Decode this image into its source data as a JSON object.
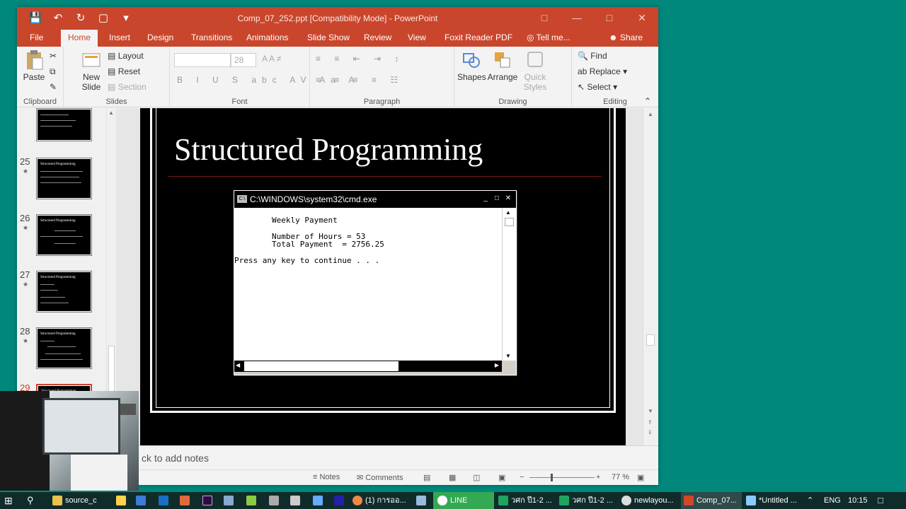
{
  "window": {
    "title": "Comp_07_252.ppt [Compatibility Mode] - PowerPoint",
    "tabs": [
      "File",
      "Home",
      "Insert",
      "Design",
      "Transitions",
      "Animations",
      "Slide Show",
      "Review",
      "View",
      "Foxit Reader PDF",
      "Tell me...",
      "Share"
    ],
    "active_tab": "Home"
  },
  "ribbon": {
    "clipboard": {
      "paste": "Paste",
      "group": "Clipboard"
    },
    "slides": {
      "new_slide": "New Slide",
      "layout": "Layout",
      "reset": "Reset",
      "section": "Section",
      "group": "Slides"
    },
    "font": {
      "size": "28",
      "group": "Font"
    },
    "paragraph": {
      "group": "Paragraph"
    },
    "drawing": {
      "shapes": "Shapes",
      "arrange": "Arrange",
      "quick_styles": "Quick Styles",
      "group": "Drawing"
    },
    "editing": {
      "find": "Find",
      "replace": "Replace",
      "select": "Select",
      "group": "Editing"
    }
  },
  "thumbnails": [
    {
      "num": "25",
      "title": "Structured Programming"
    },
    {
      "num": "26",
      "title": "Structured Programming"
    },
    {
      "num": "27",
      "title": "Structured Programming"
    },
    {
      "num": "28",
      "title": "Structured Programming"
    },
    {
      "num": "29",
      "title": "Structured Programming"
    }
  ],
  "slide": {
    "title": "Structured Programming",
    "cmd": {
      "title": "C:\\WINDOWS\\system32\\cmd.exe",
      "lines": [
        "        Weekly Payment",
        "        Number of Hours = 53",
        "        Total Payment  = 2756.25",
        "Press any key to continue . . ."
      ]
    }
  },
  "notes": {
    "placeholder": "ck to add notes"
  },
  "status": {
    "notes": "Notes",
    "comments": "Comments",
    "zoom": "77 %"
  },
  "taskbar": {
    "items": [
      "source_c",
      "(1) การออ...",
      "LINE",
      "วศก ปี1-2 ...",
      "วศก ปี1-2 ...",
      "newlayou...",
      "Comp_07...",
      "*Untitled ..."
    ],
    "lang": "ENG",
    "time": "10:15"
  },
  "colors": {
    "accent": "#c9462c",
    "desktop": "#00897b",
    "taskbar": "#0f2c2b"
  }
}
